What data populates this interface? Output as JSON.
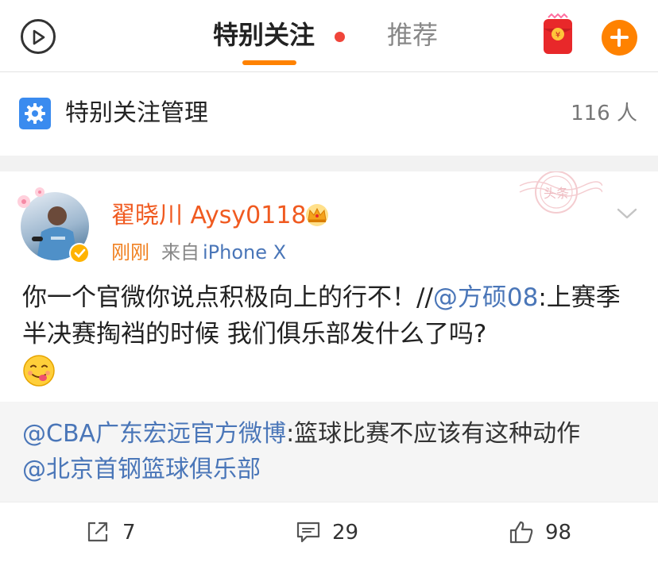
{
  "topbar": {
    "tabs": [
      {
        "label": "特别关注",
        "active": true
      },
      {
        "label": "推荐",
        "active": false
      }
    ],
    "left_icon": "play-circle-icon",
    "right_icons": [
      "red-packet-icon",
      "plus-icon"
    ],
    "accent_color": "#ff8200"
  },
  "manage": {
    "icon": "gear-icon",
    "label": "特别关注管理",
    "count": "116 人"
  },
  "post": {
    "username": "翟晓川 Aysy0118",
    "badge_icon": "crown-icon",
    "time": "刚刚",
    "source_prefix": "来自",
    "source_device": "iPhone X",
    "text_main": "你一个官微你说点积极向上的行不！//",
    "mention_1": "@方硕08",
    "text_after": ":上赛季半决赛掏裆的时候 我们俱乐部发什么了吗?",
    "emoji_icon": "licking-face-emoji",
    "stamp_text": "头条"
  },
  "repost": {
    "mention_1": "@CBA广东宏远官方微博",
    "text": ":篮球比赛不应该有这种动作",
    "mention_2": "@北京首钢篮球俱乐部"
  },
  "actions": {
    "share_count": "7",
    "comment_count": "29",
    "like_count": "98"
  }
}
